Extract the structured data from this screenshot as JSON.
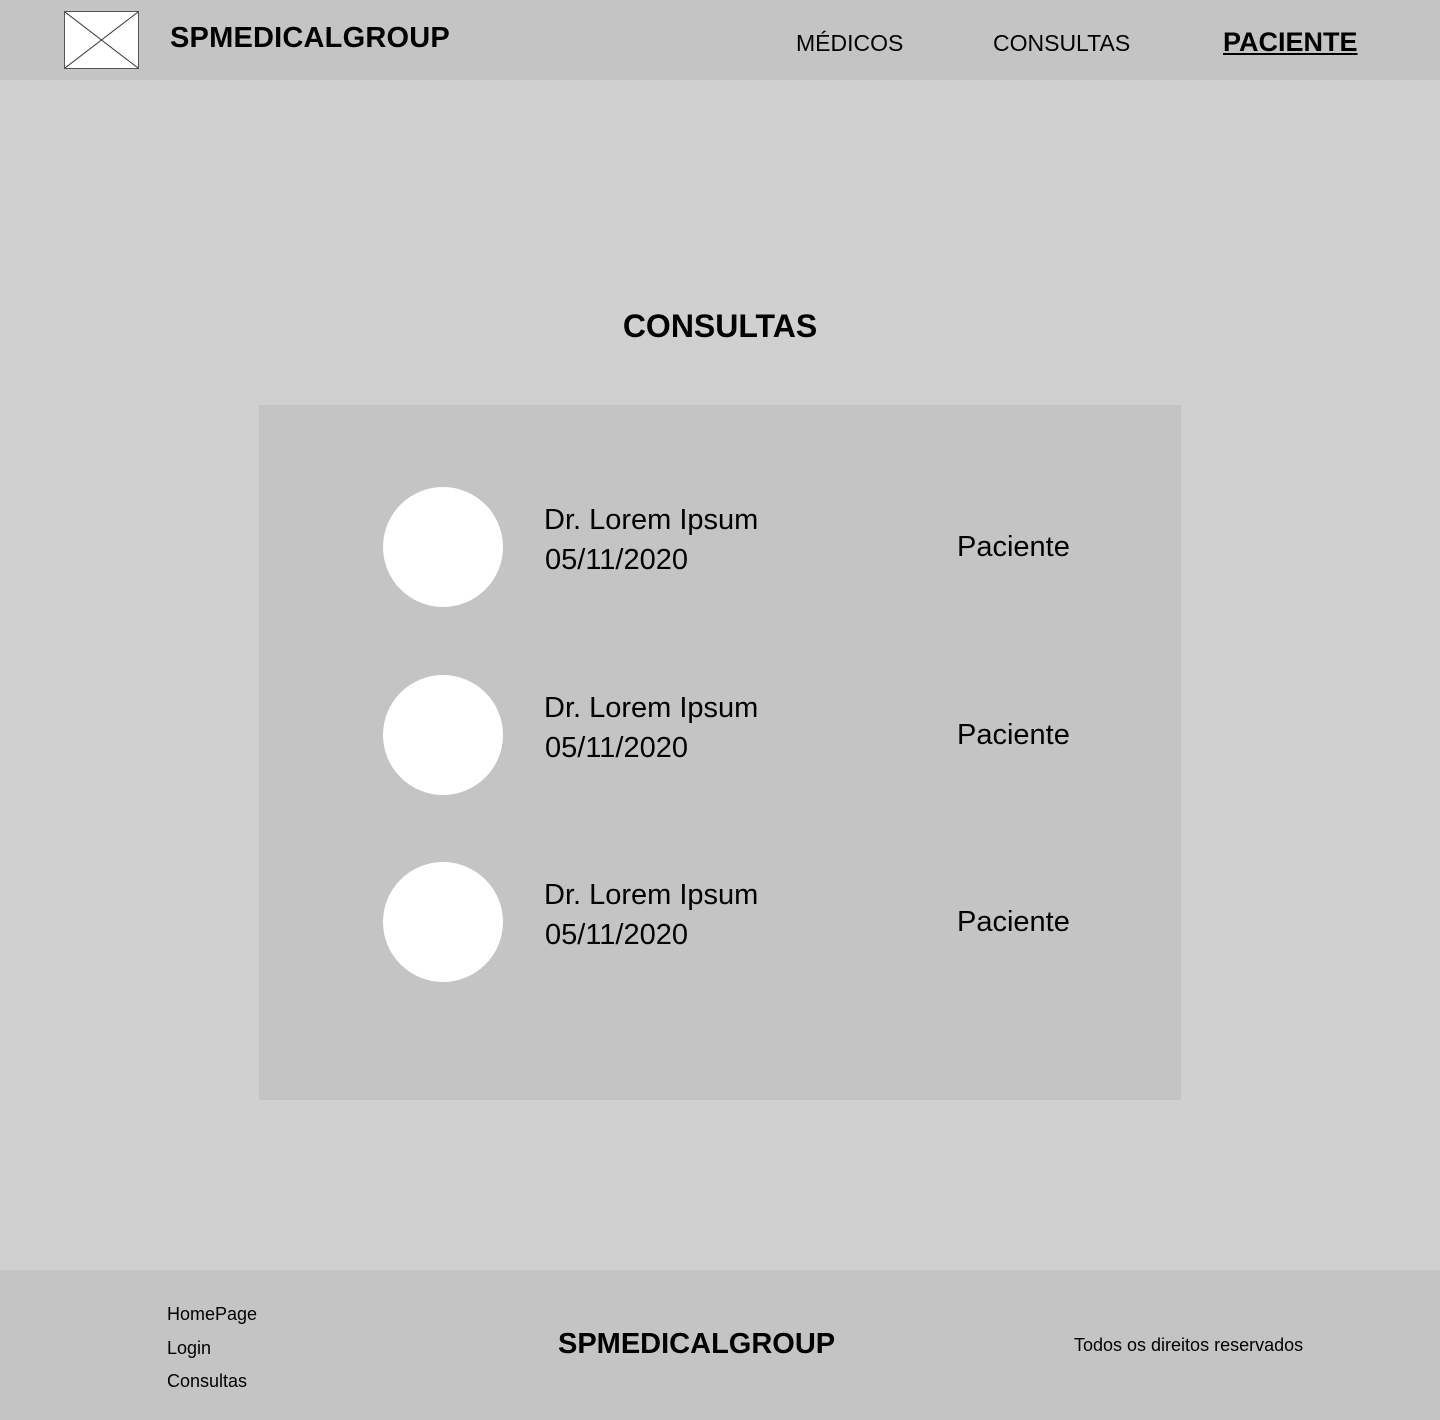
{
  "header": {
    "brand": "SPMEDICALGROUP",
    "logo_icon": "image-placeholder-icon",
    "nav": [
      {
        "label": "MÉDICOS"
      },
      {
        "label": "CONSULTAS"
      },
      {
        "label": "PACIENTE"
      }
    ]
  },
  "main": {
    "title": "CONSULTAS",
    "appointments": [
      {
        "doctor": "Dr. Lorem Ipsum",
        "date": "05/11/2020",
        "role": "Paciente"
      },
      {
        "doctor": "Dr. Lorem Ipsum",
        "date": "05/11/2020",
        "role": "Paciente"
      },
      {
        "doctor": "Dr. Lorem Ipsum",
        "date": "05/11/2020",
        "role": "Paciente"
      }
    ]
  },
  "footer": {
    "links": [
      {
        "label": "HomePage"
      },
      {
        "label": "Login"
      },
      {
        "label": "Consultas"
      }
    ],
    "brand": "SPMEDICALGROUP",
    "rights": "Todos os direitos reservados"
  }
}
